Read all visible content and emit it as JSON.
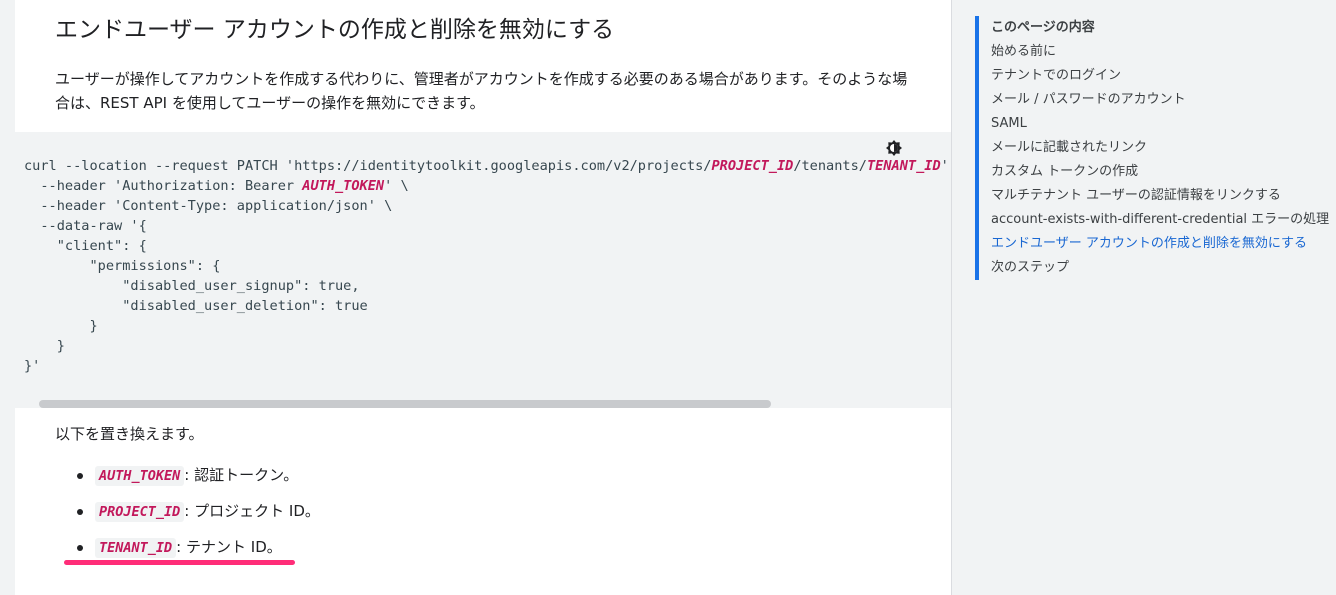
{
  "main": {
    "heading": "エンドユーザー アカウントの作成と削除を無効にする",
    "intro": "ユーザーが操作してアカウントを作成する代わりに、管理者がアカウントを作成する必要のある場合があります。そのような場合は、REST API を使用してユーザーの操作を無効にできます。",
    "code": {
      "line1_pre": "curl --location --request PATCH 'https://identitytoolkit.googleapis.com/v2/projects/",
      "line1_var1": "PROJECT_ID",
      "line1_mid": "/tenants/",
      "line1_var2": "TENANT_ID",
      "line1_post": "' \\",
      "line2_pre": "  --header 'Authorization: Bearer ",
      "line2_var": "AUTH_TOKEN",
      "line2_post": "' \\",
      "line3": "  --header 'Content-Type: application/json' \\",
      "line4": "  --data-raw '{",
      "line5": "    \"client\": {",
      "line6": "        \"permissions\": {",
      "line7": "            \"disabled_user_signup\": true,",
      "line8": "            \"disabled_user_deletion\": true",
      "line9": "        }",
      "line10": "    }",
      "line11": "}'"
    },
    "replace_label": "以下を置き換えます。",
    "params": [
      {
        "name": "AUTH_TOKEN",
        "desc": "認証トークン。"
      },
      {
        "name": "PROJECT_ID",
        "desc": "プロジェクト ID。"
      },
      {
        "name": "TENANT_ID",
        "desc": "テナント ID。"
      }
    ],
    "separator": ":"
  },
  "toc": {
    "title": "このページの内容",
    "items": [
      "始める前に",
      "テナントでのログイン",
      "メール / パスワードのアカウント",
      "SAML",
      "メールに記載されたリンク",
      "カスタム トークンの作成",
      "マルチテナント ユーザーの認証情報をリンクする",
      "account-exists-with-different-credential エラーの処理",
      "エンドユーザー アカウントの作成と削除を無効にする",
      "次のステップ"
    ],
    "active_index": 8
  },
  "colors": {
    "accent": "#1a73e8",
    "variable": "#c2185b",
    "highlight": "#ff2d78"
  },
  "icons": {
    "theme_toggle": "brightness-icon"
  }
}
